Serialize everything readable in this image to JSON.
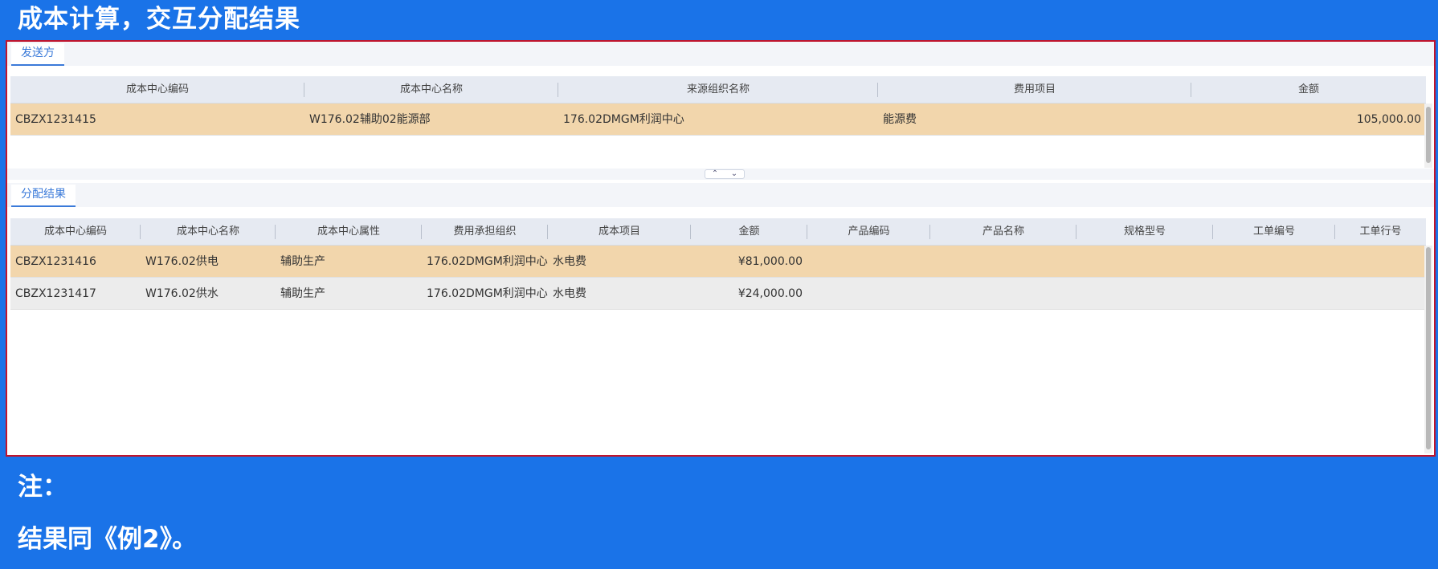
{
  "slide": {
    "title": "成本计算，交互分配结果",
    "note_label": "注：",
    "note_text": "结果同《例2》。"
  },
  "sender": {
    "tab_label": "发送方",
    "columns": [
      "成本中心编码",
      "成本中心名称",
      "来源组织名称",
      "费用项目",
      "金额"
    ],
    "rows": [
      [
        "CBZX1231415",
        "W176.02辅助02能源部",
        "176.02DMGM利润中心",
        "能源费",
        "105,000.00"
      ]
    ]
  },
  "result": {
    "tab_label": "分配结果",
    "columns": [
      "成本中心编码",
      "成本中心名称",
      "成本中心属性",
      "费用承担组织",
      "成本项目",
      "金额",
      "产品编码",
      "产品名称",
      "规格型号",
      "工单编号",
      "工单行号"
    ],
    "rows": [
      [
        "CBZX1231416",
        "W176.02供电",
        "辅助生产",
        "176.02DMGM利润中心",
        "水电费",
        "¥81,000.00",
        "",
        "",
        "",
        "",
        ""
      ],
      [
        "CBZX1231417",
        "W176.02供水",
        "辅助生产",
        "176.02DMGM利润中心",
        "水电费",
        "¥24,000.00",
        "",
        "",
        "",
        "",
        ""
      ]
    ]
  },
  "icons": {
    "collapse_up": "chevron-up-icon",
    "expand_down": "chevron-down-icon"
  },
  "colors": {
    "background": "#1a73e8",
    "panel_border": "#c0142c",
    "selected_row": "#f2d6ac",
    "alt_row": "#ececec",
    "tab_accent": "#3a7ad9"
  }
}
